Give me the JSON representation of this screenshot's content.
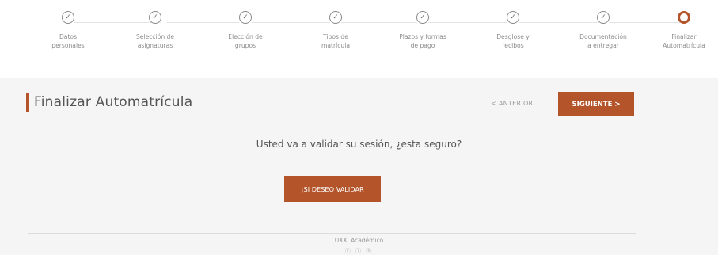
{
  "stepper": {
    "steps": [
      {
        "label": "Datos\npersonales",
        "state": "done"
      },
      {
        "label": "Selección de\nasignaturas",
        "state": "done"
      },
      {
        "label": "Elección de\ngrupos",
        "state": "done"
      },
      {
        "label": "Tipos de\nmatrícula",
        "state": "done"
      },
      {
        "label": "Plazos y formas\nde pago",
        "state": "done"
      },
      {
        "label": "Desglose y\nrecibos",
        "state": "done"
      },
      {
        "label": "Documentación\na entregar",
        "state": "done"
      },
      {
        "label": "Finalizar\nAutomatrícula",
        "state": "current"
      }
    ],
    "done_icon": "check-icon",
    "current_icon": "ring-icon",
    "accent_color": "#b3542a"
  },
  "header": {
    "title": "Finalizar Automatrícula",
    "prev_label": "< ANTERIOR",
    "next_label": "SIGUIENTE >"
  },
  "main": {
    "question": "Usted va a validar su sesión, ¿esta seguro?",
    "confirm_label": "¡SI DESEO VALIDAR"
  },
  "footer": {
    "text": "UXXI Académico",
    "icons": "cc-license-icons"
  },
  "colors": {
    "accent": "#b3542a",
    "background": "#f5f5f5",
    "stepper_background": "#ffffff"
  }
}
